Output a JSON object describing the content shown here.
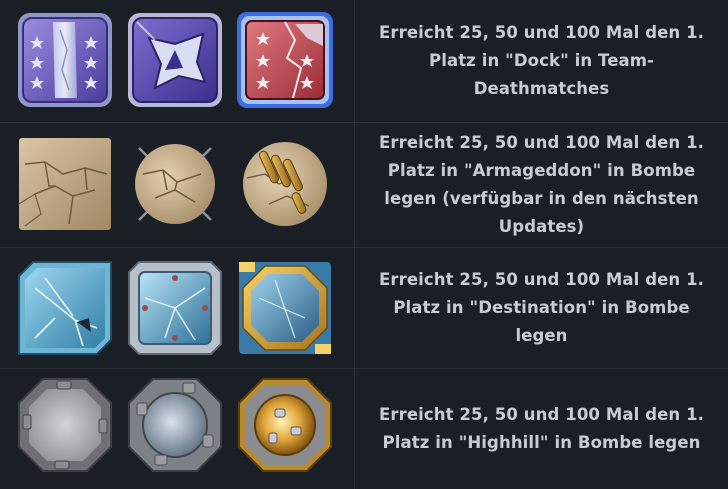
{
  "achievements": [
    {
      "theme": "dock",
      "description": "Erreicht 25, 50 und 100 Mal den 1. Platz in \"Dock\" in Team-Deathmatches",
      "icons": [
        "dock-bronze-badge-icon",
        "dock-silver-badge-icon",
        "dock-gold-badge-icon"
      ]
    },
    {
      "theme": "armageddon",
      "description": "Erreicht 25, 50 und 100 Mal den 1. Platz in \"Armageddon\" in Bombe legen (verfügbar in den nächsten Updates)",
      "icons": [
        "armageddon-bronze-badge-icon",
        "armageddon-silver-badge-icon",
        "armageddon-gold-badge-icon"
      ]
    },
    {
      "theme": "destination",
      "description": "Erreicht 25, 50 und 100 Mal den 1. Platz in \"Destination\" in Bombe legen",
      "icons": [
        "destination-bronze-badge-icon",
        "destination-silver-badge-icon",
        "destination-gold-badge-icon"
      ]
    },
    {
      "theme": "highhill",
      "description": "Erreicht 25, 50 und 100 Mal den 1. Platz in \"Highhill\" in Bombe legen",
      "icons": [
        "highhill-bronze-badge-icon",
        "highhill-silver-badge-icon",
        "highhill-gold-badge-icon"
      ]
    }
  ],
  "colors": {
    "background": "#1a1f25",
    "divider": "#2a3038",
    "text": "#c7ccd1"
  }
}
